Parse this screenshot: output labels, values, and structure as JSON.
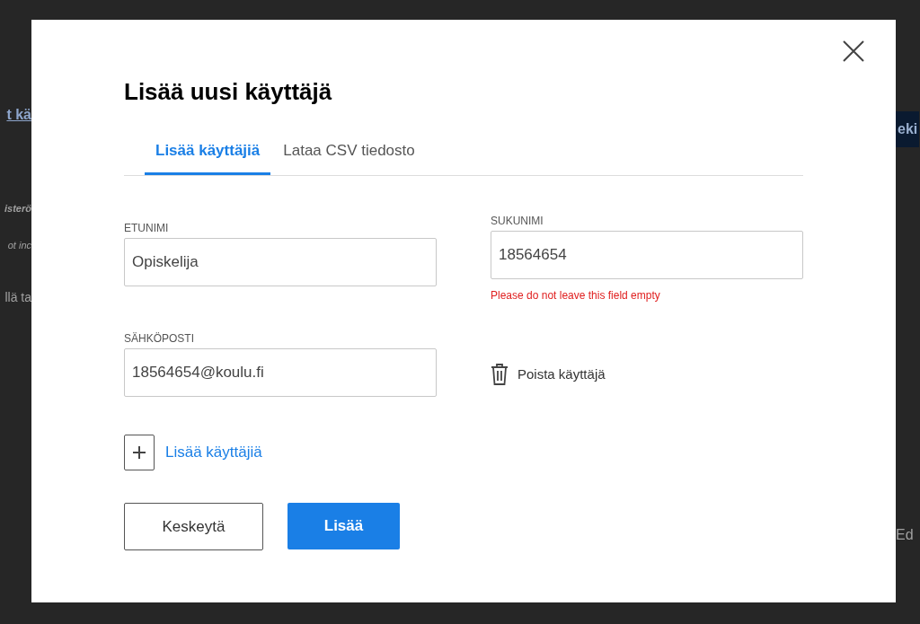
{
  "background": {
    "left_fragments": [
      {
        "kind": "link",
        "text": "t kä"
      },
      {
        "kind": "italic-bold",
        "text": "isterö"
      },
      {
        "kind": "italic",
        "text": "ot inc"
      },
      {
        "kind": "plain",
        "text": "llä ta"
      }
    ],
    "right_fragments": [
      {
        "kind": "button",
        "text": "eki"
      },
      {
        "kind": "plain",
        "text": "Ed"
      }
    ]
  },
  "dialog": {
    "title": "Lisää uusi käyttäjä",
    "tabs": [
      {
        "label": "Lisää käyttäjiä",
        "selected": true
      },
      {
        "label": "Lataa CSV tiedosto",
        "selected": false
      }
    ],
    "first_name": {
      "label": "ETUNIMI",
      "value": "Opiskelija"
    },
    "last_name": {
      "label": "SUKUNIMI",
      "value": "18564654",
      "error": "Please do not leave this field empty"
    },
    "email": {
      "label": "SÄHKÖPOSTI",
      "value": "18564654@koulu.fi"
    },
    "remove_user": "Poista käyttäjä",
    "add_users": "Lisää käyttäjiä",
    "cancel": "Keskeytä",
    "submit": "Lisää"
  }
}
